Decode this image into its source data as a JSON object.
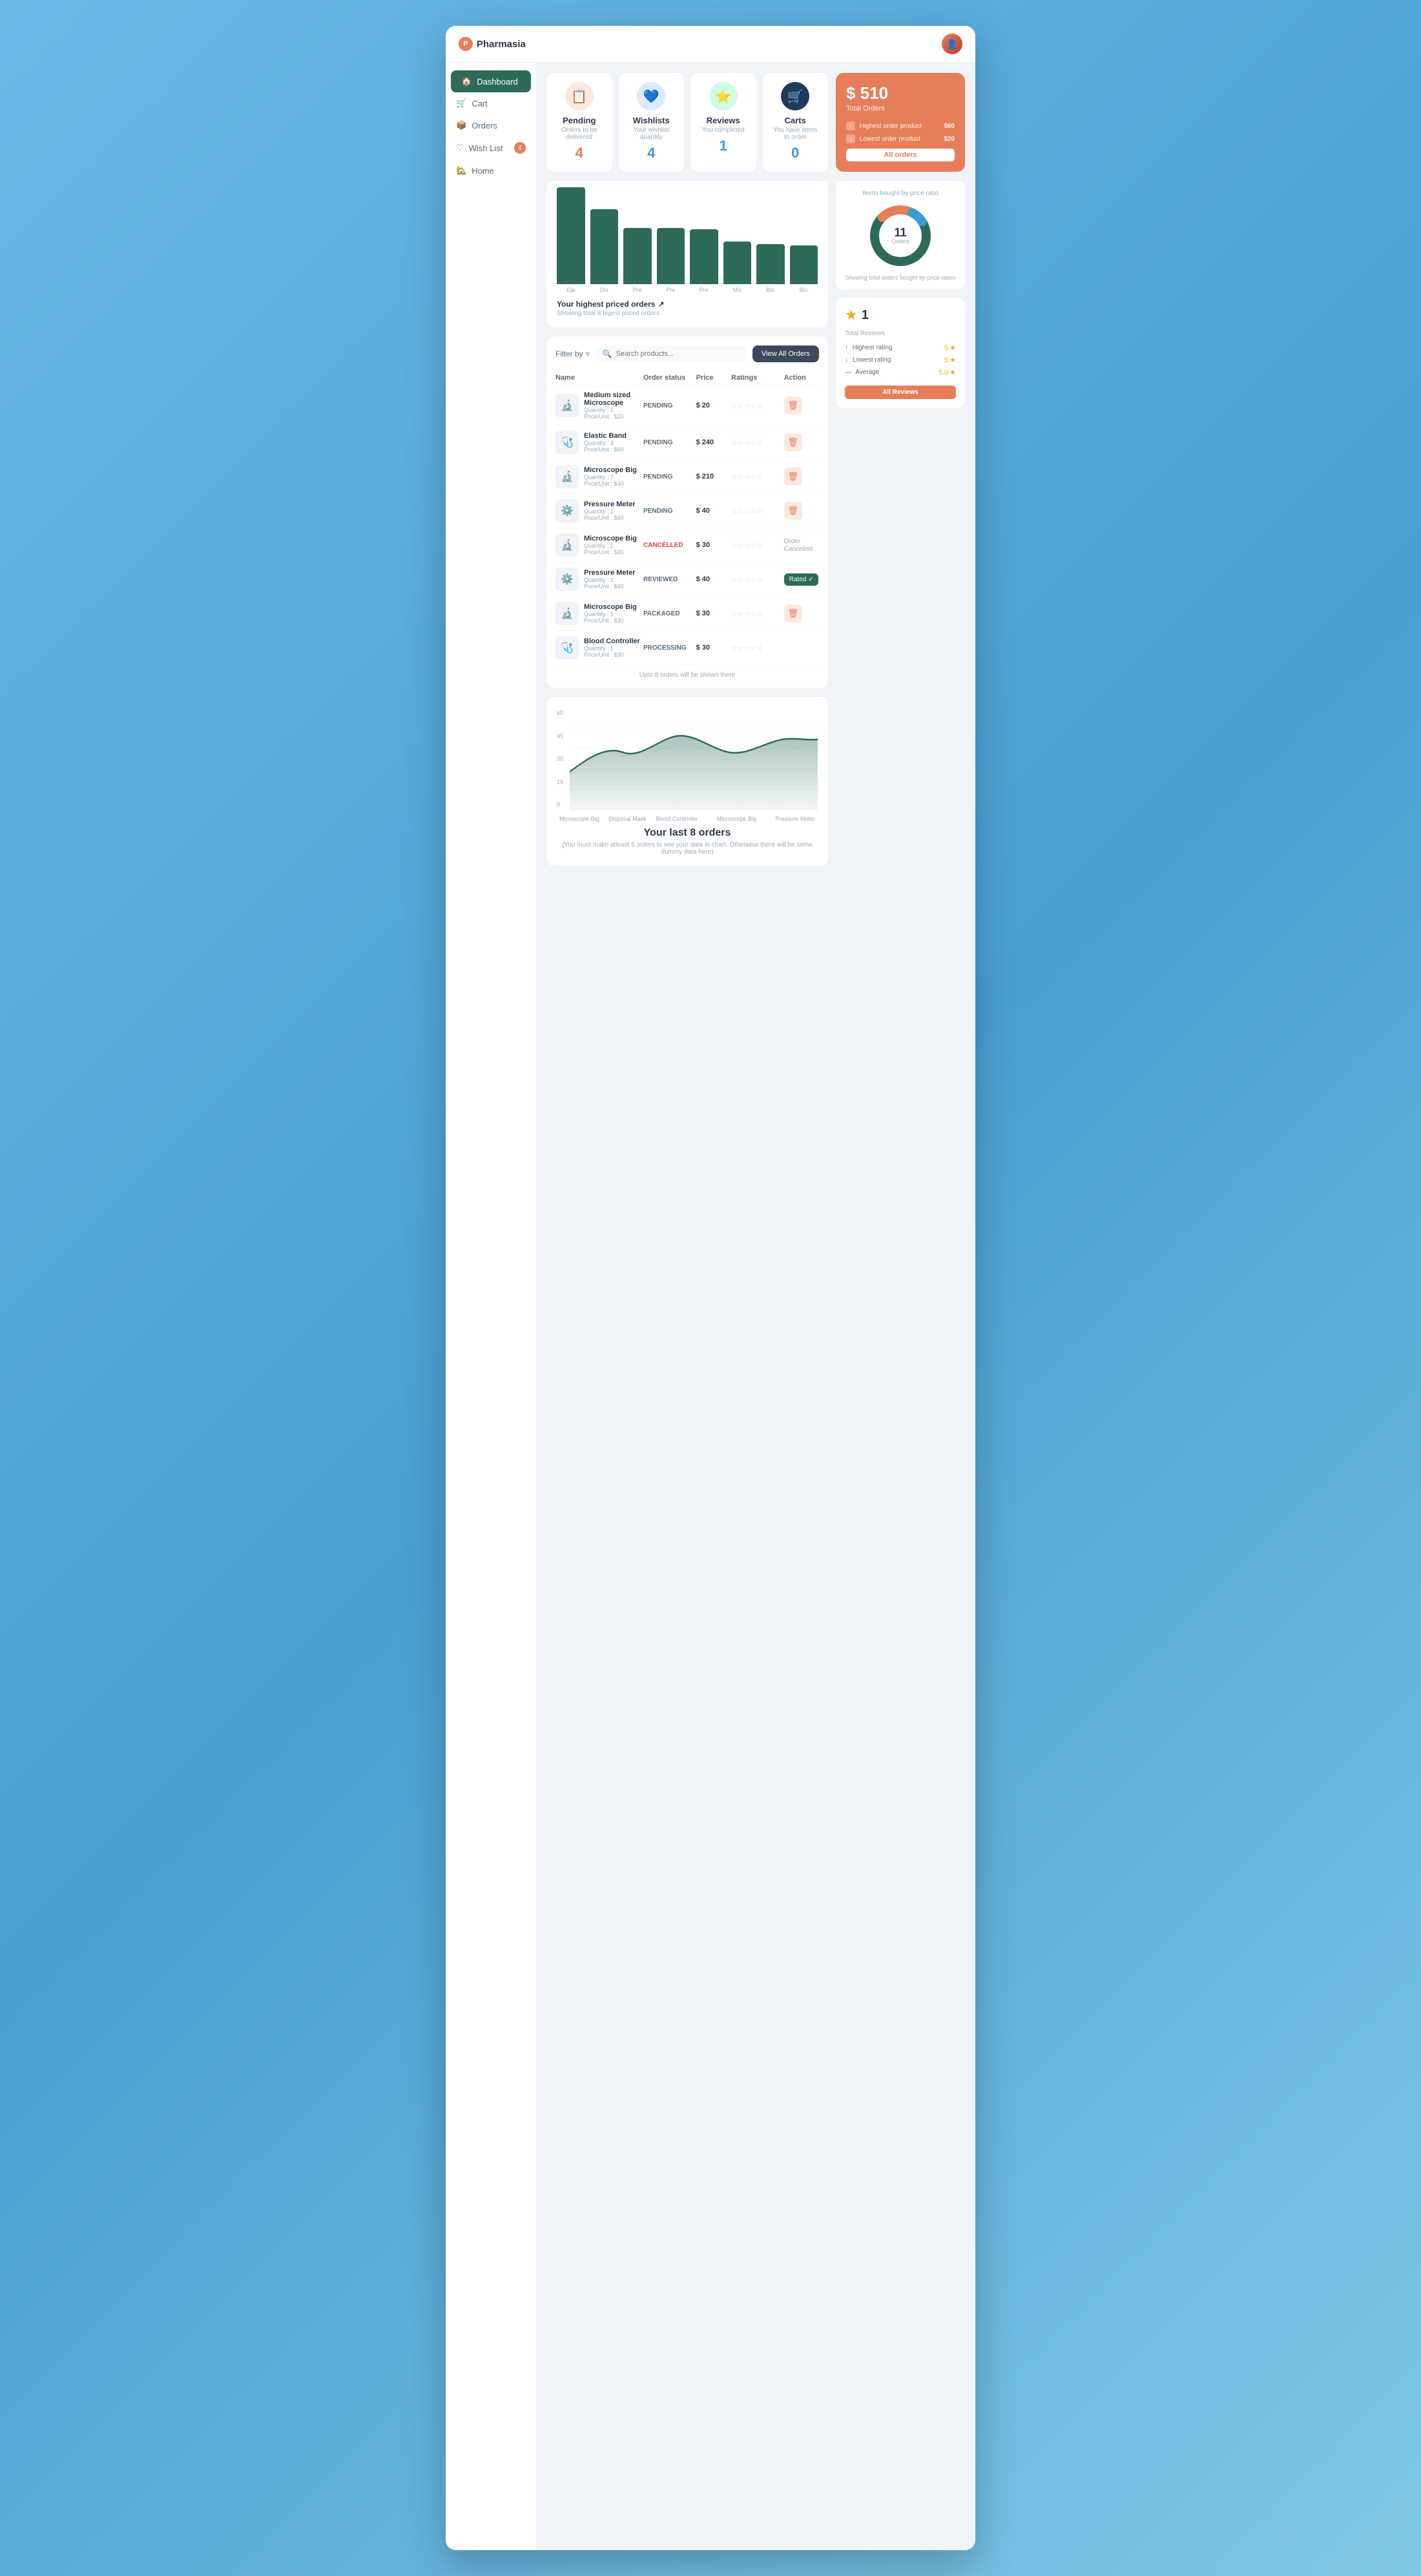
{
  "app": {
    "name": "Pharmasia",
    "user_avatar": "👤"
  },
  "sidebar": {
    "items": [
      {
        "label": "Dashboard",
        "icon": "🏠",
        "active": true,
        "badge": null
      },
      {
        "label": "Cart",
        "icon": "🛒",
        "active": false,
        "badge": null
      },
      {
        "label": "Orders",
        "icon": "📦",
        "active": false,
        "badge": null
      },
      {
        "label": "Wish List",
        "icon": "♡",
        "active": false,
        "badge": "4"
      },
      {
        "label": "Home",
        "icon": "🏡",
        "active": false,
        "badge": null
      }
    ]
  },
  "stats": {
    "pending": {
      "title": "Pending",
      "desc": "Orders to be delivered",
      "value": "4",
      "icon": "📋"
    },
    "wishlists": {
      "title": "Wishlists",
      "desc": "Your wishlist quantity",
      "value": "4",
      "icon": "💙"
    },
    "reviews": {
      "title": "Reviews",
      "desc": "You completed",
      "value": "1",
      "icon": "⭐"
    },
    "carts": {
      "title": "Carts",
      "desc": "You have items to order",
      "value": "0",
      "icon": "🛒"
    }
  },
  "total_orders": {
    "amount": "$ 510",
    "label": "Total Orders",
    "highest_label": "Highest order product",
    "highest_value": "$60",
    "lowest_label": "Lowest order product",
    "lowest_value": "$20",
    "btn_label": "All orders"
  },
  "bar_chart": {
    "title": "Your highest priced orders",
    "subtitle": "Showing total 8 higest priced orders",
    "bars": [
      {
        "label": "Ela",
        "height": 155
      },
      {
        "label": "Dis",
        "height": 120
      },
      {
        "label": "Pre",
        "height": 90
      },
      {
        "label": "Pre",
        "height": 90
      },
      {
        "label": "Pre",
        "height": 88
      },
      {
        "label": "Mic",
        "height": 68
      },
      {
        "label": "Blo",
        "height": 64
      },
      {
        "label": "Blo",
        "height": 62
      }
    ]
  },
  "donut_chart": {
    "title": "Items bought by price ratio",
    "center_num": "11",
    "center_label": "Orders",
    "subtitle": "Showing total orders bought by price ration"
  },
  "reviews_panel": {
    "count": "1",
    "label": "Total Reviews",
    "highest_label": "Highest rating",
    "highest_value": "5",
    "lowest_label": "Lowest rating",
    "lowest_value": "5",
    "average_label": "Average",
    "average_value": "5.0",
    "btn_label": "All Reviews"
  },
  "orders_table": {
    "filter_label": "Filter by",
    "search_placeholder": "Search products...",
    "view_all_label": "View All Orders",
    "headers": [
      "Name",
      "Order status",
      "Price",
      "Ratings",
      "Action"
    ],
    "footer_note": "Upto 8 orders will be shown there",
    "rows": [
      {
        "name": "Medium sized Microscope",
        "qty": "Quantity : 1",
        "price_unit": "Price/Unit : $20",
        "status": "PENDING",
        "status_type": "pending",
        "price": "$ 20",
        "icon": "🔬",
        "action": "delete",
        "rated": false,
        "cancelled": false
      },
      {
        "name": "Elastic Band",
        "qty": "Quantity : 4",
        "price_unit": "Price/Unit : $60",
        "status": "PENDING",
        "status_type": "pending",
        "price": "$ 240",
        "icon": "🩺",
        "action": "delete",
        "rated": false,
        "cancelled": false
      },
      {
        "name": "Microscope Big",
        "qty": "Quantity : 7",
        "price_unit": "Price/Unit : $30",
        "status": "PENDING",
        "status_type": "pending",
        "price": "$ 210",
        "icon": "🔬",
        "action": "delete",
        "rated": false,
        "cancelled": false
      },
      {
        "name": "Pressure Meter",
        "qty": "Quantity : 1",
        "price_unit": "Price/Unit : $40",
        "status": "PENDING",
        "status_type": "pending",
        "price": "$ 40",
        "icon": "⚙️",
        "action": "delete",
        "rated": false,
        "cancelled": false
      },
      {
        "name": "Microscope Big",
        "qty": "Quantity : 1",
        "price_unit": "Price/Unit : $30",
        "status": "CANCELLED",
        "status_type": "cancelled",
        "price": "$ 30",
        "icon": "🔬",
        "action": "cancelled",
        "rated": false,
        "cancelled": true
      },
      {
        "name": "Pressure Meter",
        "qty": "Quantity : 1",
        "price_unit": "Price/Unit : $40",
        "status": "REVIEWED",
        "status_type": "reviewed",
        "price": "$ 40",
        "icon": "⚙️",
        "action": "rated",
        "rated": true,
        "cancelled": false
      },
      {
        "name": "Microscope Big",
        "qty": "Quantity : 1",
        "price_unit": "Price/Unit : $30",
        "status": "PACKAGED",
        "status_type": "packaged",
        "price": "$ 30",
        "icon": "🔬",
        "action": "delete",
        "rated": false,
        "cancelled": false
      },
      {
        "name": "Blood Controller",
        "qty": "Quantity : 1",
        "price_unit": "Price/Unit : $30",
        "status": "PROCESSING",
        "status_type": "processing",
        "price": "$ 30",
        "icon": "🩺",
        "action": "none",
        "rated": false,
        "cancelled": false
      }
    ]
  },
  "line_chart": {
    "title": "Your last 8 orders",
    "subtitle": "(You must make atleast 5 orders to see your data in chart. Otherwise there will be some dummy data here)",
    "x_labels": [
      "Microscope Big",
      "Disposal Mask",
      "Blood Controller",
      "",
      "Microscope Big",
      "",
      "Pressure Meter"
    ],
    "y_labels": [
      "60",
      "45",
      "30",
      "15",
      "0"
    ]
  }
}
